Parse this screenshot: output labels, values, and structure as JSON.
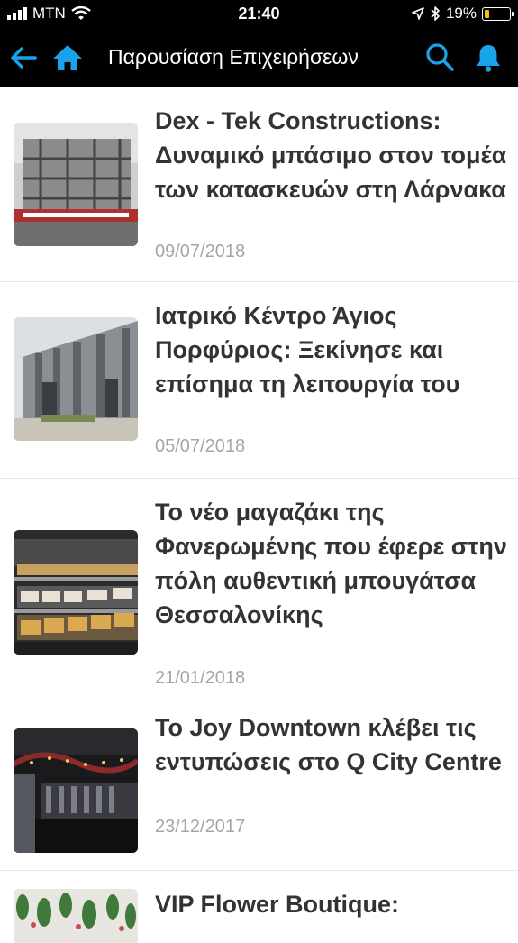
{
  "status_bar": {
    "carrier": "MTN",
    "time": "21:40",
    "battery": "19%",
    "battery_level": 0.19
  },
  "nav": {
    "title": "Παρουσίαση Επιχειρήσεων",
    "back_icon": "arrow-left-icon",
    "home_icon": "home-icon",
    "search_icon": "search-icon",
    "bell_icon": "bell-icon",
    "accent": "#1aa3e8"
  },
  "articles": [
    {
      "title": "Dex - Tek Constructions: Δυναμικό μπάσιμο στον τομέα των κατασκευών στη Λάρνακα",
      "date": "09/07/2018"
    },
    {
      "title": "Ιατρικό Κέντρο Άγιος Πορφύριος: Ξεκίνησε και επίσημα τη λειτουργία του",
      "date": "05/07/2018"
    },
    {
      "title": "Το νέο μαγαζάκι της Φανερωμένης που έφερε στην πόλη αυθεντική μπουγάτσα Θεσσαλονίκης",
      "date": "21/01/2018"
    },
    {
      "title": "Το Joy Downtown κλέβει τις εντυπώσεις στο Q City Centre",
      "date": "23/12/2017"
    },
    {
      "title": "VIP Flower Boutique:",
      "date": ""
    }
  ]
}
